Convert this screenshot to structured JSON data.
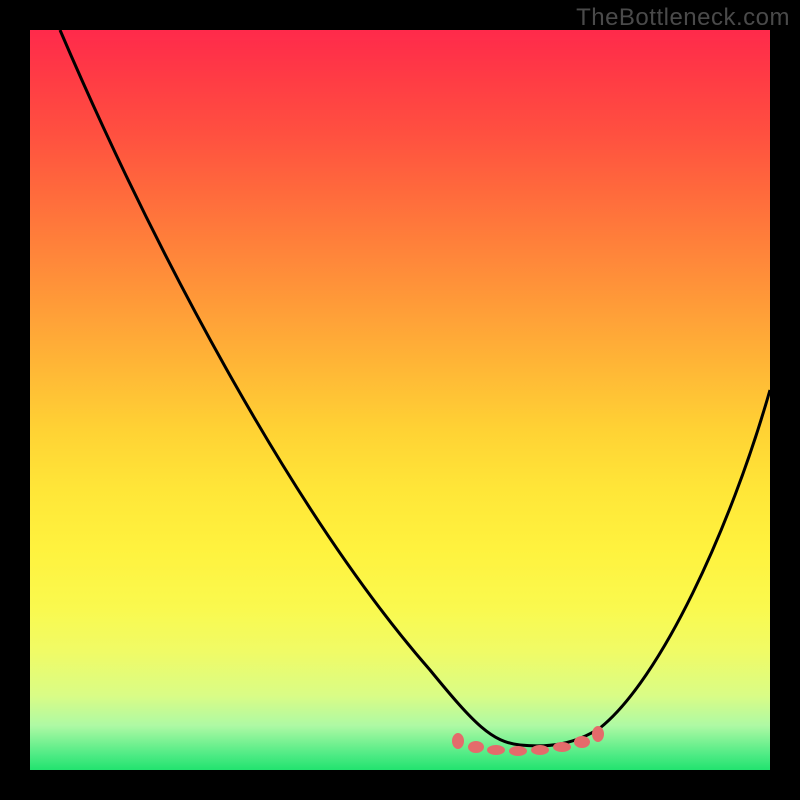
{
  "watermark": "TheBottleneck.com",
  "colors": {
    "frame_bg": "#000000",
    "gradient_top": "#ff2a4b",
    "gradient_bottom": "#22e36f",
    "curve": "#000000",
    "dash": "#e46b6b"
  },
  "chart_data": {
    "type": "line",
    "title": "",
    "xlabel": "",
    "ylabel": "",
    "xlim": [
      0,
      100
    ],
    "ylim": [
      0,
      100
    ],
    "x": [
      0,
      5,
      10,
      15,
      20,
      25,
      30,
      35,
      40,
      45,
      50,
      55,
      58,
      61,
      64,
      67,
      70,
      73,
      76,
      78,
      82,
      86,
      90,
      94,
      98,
      100
    ],
    "values": [
      100,
      92,
      84,
      76,
      68,
      60,
      52,
      44,
      36,
      28,
      20,
      12,
      8,
      5,
      3,
      2,
      1.5,
      1.5,
      2,
      3,
      8,
      16,
      25,
      35,
      44,
      48
    ],
    "optimal_band_x": [
      58,
      78
    ],
    "annotations": []
  }
}
